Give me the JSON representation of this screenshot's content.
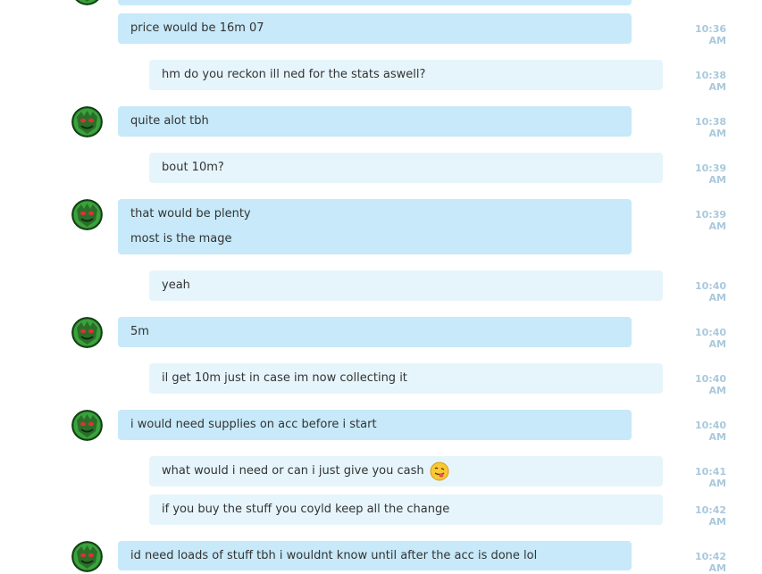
{
  "colors": {
    "incoming_bubble": "#c7e9f9",
    "outgoing_bubble": "#e6f5fc",
    "timestamp": "#a9c9dc",
    "text": "#333333",
    "avatar": "#2f8a2f"
  },
  "icons": {
    "avatar": "green-monster-avatar-icon",
    "emoji": "tongue-out-smiley-icon"
  },
  "messages": [
    {
      "from": "contact",
      "lines": [
        "price would be 16m 07"
      ],
      "time": "10:36 AM"
    },
    {
      "from": "me",
      "lines": [
        "hm do you reckon ill ned for the stats aswell?"
      ],
      "time": "10:38 AM"
    },
    {
      "from": "contact",
      "lines": [
        "quite alot tbh"
      ],
      "time": "10:38 AM"
    },
    {
      "from": "me",
      "lines": [
        "bout 10m?"
      ],
      "time": "10:39 AM"
    },
    {
      "from": "contact",
      "lines": [
        "that would be plenty",
        "most is the mage"
      ],
      "time": "10:39 AM"
    },
    {
      "from": "me",
      "lines": [
        "yeah"
      ],
      "time": "10:40 AM"
    },
    {
      "from": "contact",
      "lines": [
        "5m"
      ],
      "time": "10:40 AM"
    },
    {
      "from": "me",
      "lines": [
        "il get 10m just in case im now collecting it"
      ],
      "time": "10:40 AM"
    },
    {
      "from": "contact",
      "lines": [
        "i would need supplies on acc before i start"
      ],
      "time": "10:40 AM"
    },
    {
      "from": "me",
      "lines": [
        "what would i need or can i just give you cash"
      ],
      "time": "10:41 AM"
    },
    {
      "from": "me",
      "lines": [
        "if you buy the stuff you coyld keep all the change"
      ],
      "time": "10:42 AM"
    },
    {
      "from": "contact",
      "lines": [
        "id need loads of stuff tbh i wouldnt know until after the acc is done lol"
      ],
      "time": "10:42 AM"
    }
  ]
}
